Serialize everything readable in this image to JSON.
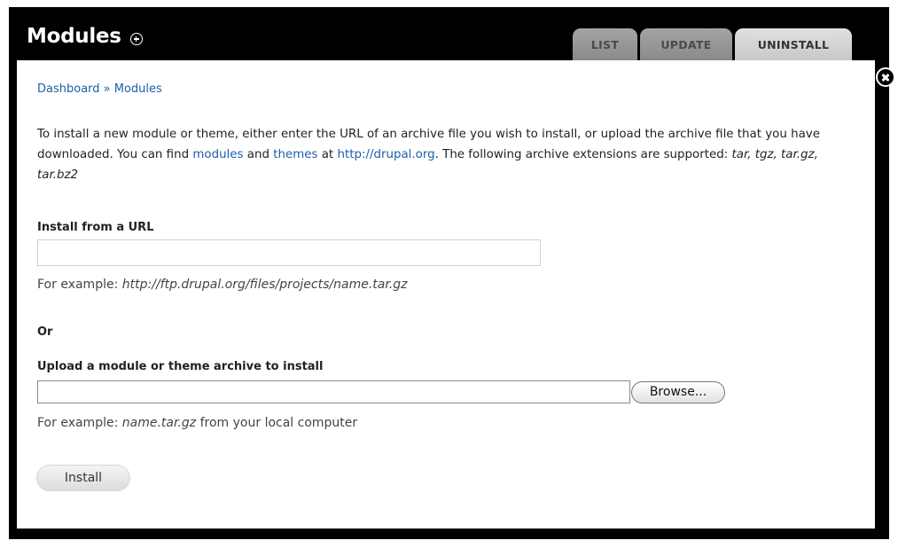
{
  "header": {
    "title": "Modules",
    "add_icon": "plus-circle-icon"
  },
  "tabs": [
    {
      "label": "LIST",
      "active": false
    },
    {
      "label": "UPDATE",
      "active": false
    },
    {
      "label": "UNINSTALL",
      "active": true
    }
  ],
  "close_icon": "close-x-circle-icon",
  "breadcrumb": {
    "dashboard": "Dashboard",
    "separator": " » ",
    "modules": "Modules"
  },
  "intro": {
    "part1": "To install a new module or theme, either enter the URL of an archive file you wish to install, or upload the archive file that you have downloaded. You can find ",
    "modules_link": "modules",
    "and": " and ",
    "themes_link": "themes",
    "at": " at ",
    "drupal_link": "http://drupal.org",
    "part2": ". The following archive extensions are supported: ",
    "extensions": "tar, tgz, tar.gz, tar.bz2"
  },
  "url_section": {
    "label": "Install from a URL",
    "value": "",
    "help_prefix": "For example: ",
    "help_example": "http://ftp.drupal.org/files/projects/name.tar.gz"
  },
  "or_label": "Or",
  "upload_section": {
    "label": "Upload a module or theme archive to install",
    "value": "",
    "browse_label": "Browse...",
    "help_prefix": "For example: ",
    "help_example": "name.tar.gz",
    "help_suffix": " from your local computer"
  },
  "install_button": "Install",
  "colors": {
    "link": "#1d5fa8",
    "overlay": "#000000",
    "tab": "#9a9a9a",
    "active_tab": "#d4d4d4"
  }
}
